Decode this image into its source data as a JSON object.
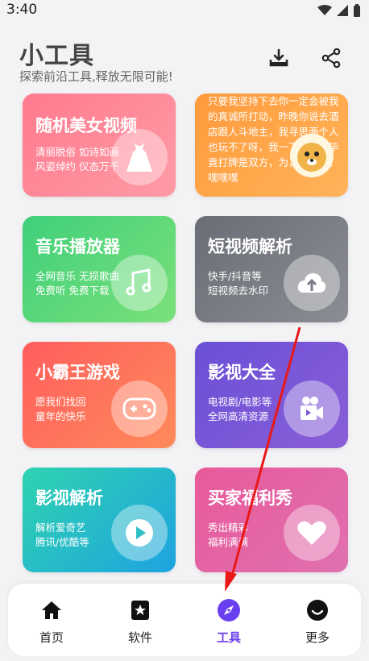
{
  "status": {
    "time": "3:40"
  },
  "header": {
    "title": "小工具",
    "subtitle": "探索前沿工具,释放无限可能!"
  },
  "cards": [
    {
      "title": "随机美女视频",
      "desc1": "清丽脱俗 如诗如画",
      "desc2": "风姿绰约 仪态万千",
      "color1": "#ff7a8e",
      "color2": "#ff9ba6"
    },
    {
      "text": "只要我坚持下去你一定会被我的真诚所打动，昨晚你说去酒店跟人斗地主，我寻思两个人也玩不了呀，我一下想了，毕竟打牌是双方，为，不太好。嘿嘿嘿",
      "color1": "#ff9a3c",
      "color2": "#ffb45a"
    },
    {
      "title": "音乐播放器",
      "desc1": "全网音乐 无损歌曲",
      "desc2": "免费听 免费下载",
      "color1": "#3fd07a",
      "color2": "#7be07a"
    },
    {
      "title": "短视频解析",
      "desc1": "快手/抖音等",
      "desc2": "短视频去水印",
      "color1": "#6a6d75",
      "color2": "#8a8d94"
    },
    {
      "title": "小霸王游戏",
      "desc1": "愿我们找回",
      "desc2": "童年的快乐",
      "color1": "#ff5e5e",
      "color2": "#ff8a5a"
    },
    {
      "title": "影视大全",
      "desc1": "电视剧/电影等",
      "desc2": "全网高清资源",
      "color1": "#6a4fd6",
      "color2": "#8a5fd8"
    },
    {
      "title": "影视解析",
      "desc1": "解析爱奇艺",
      "desc2": "腾讯/优酷等",
      "color1": "#2fd3b0",
      "color2": "#1ea3e0"
    },
    {
      "title": "买家福利秀",
      "desc1": "秀出精彩",
      "desc2": "福利满满",
      "color1": "#e85a9a",
      "color2": "#e070b0"
    }
  ],
  "nav": [
    {
      "label": "首页",
      "icon": "home-icon"
    },
    {
      "label": "软件",
      "icon": "star-box-icon"
    },
    {
      "label": "工具",
      "icon": "compass-icon"
    },
    {
      "label": "更多",
      "icon": "smile-icon"
    }
  ],
  "colors": {
    "accent": "#6a3ff0",
    "arrow": "#e81818"
  }
}
